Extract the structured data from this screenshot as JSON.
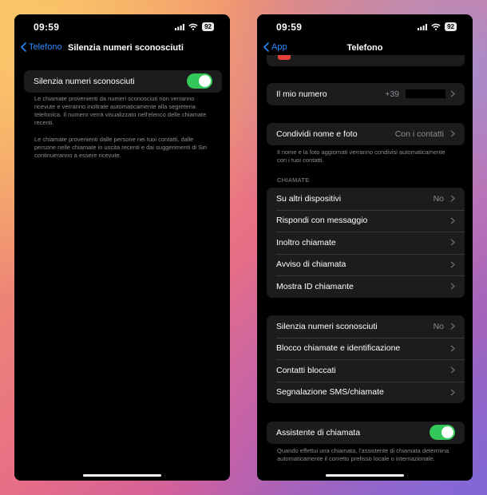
{
  "status": {
    "time": "09:59",
    "battery": "92"
  },
  "left": {
    "back_label": "Telefono",
    "title": "Silenzia numeri sconosciuti",
    "toggle_label": "Silenzia numeri sconosciuti",
    "toggle_on": true,
    "footnote1": "Le chiamate provenienti da numeri sconosciuti non verranno ricevute e verranno inoltrate automaticamente alla segreteria telefonica. Il numero verrà visualizzato nell'elenco delle chiamate recenti.",
    "footnote2": "Le chiamate provenienti dalle persone nei tuoi contatti, dalle persone nelle chiamate in uscita recenti e dai suggerimenti di Siri continueranno a essere ricevute."
  },
  "right": {
    "back_label": "App",
    "title": "Telefono",
    "my_number": {
      "label": "Il mio numero",
      "value": "+39"
    },
    "share": {
      "label": "Condividi nome e foto",
      "value": "Con i contatti"
    },
    "share_footnote": "Il nome e la foto aggiornati verranno condivisi automaticamente con i tuoi contatti.",
    "calls_header": "CHIAMATE",
    "calls": [
      {
        "label": "Su altri dispositivi",
        "value": "No"
      },
      {
        "label": "Rispondi con messaggio",
        "value": ""
      },
      {
        "label": "Inoltro chiamate",
        "value": ""
      },
      {
        "label": "Avviso di chiamata",
        "value": ""
      },
      {
        "label": "Mostra ID chiamante",
        "value": ""
      }
    ],
    "blocking": [
      {
        "label": "Silenzia numeri sconosciuti",
        "value": "No"
      },
      {
        "label": "Blocco chiamate e identificazione",
        "value": ""
      },
      {
        "label": "Contatti bloccati",
        "value": ""
      },
      {
        "label": "Segnalazione SMS/chiamate",
        "value": ""
      }
    ],
    "assist": {
      "label": "Assistente di chiamata",
      "on": true
    },
    "assist_footnote": "Quando effettui una chiamata, l'assistente di chiamata determina automaticamente il corretto prefisso locale o internazionale."
  },
  "colors": {
    "accent": "#2f8bff",
    "toggle_on": "#34c759",
    "cell_bg": "#1c1c1e",
    "secondary_text": "#8d8d93"
  }
}
